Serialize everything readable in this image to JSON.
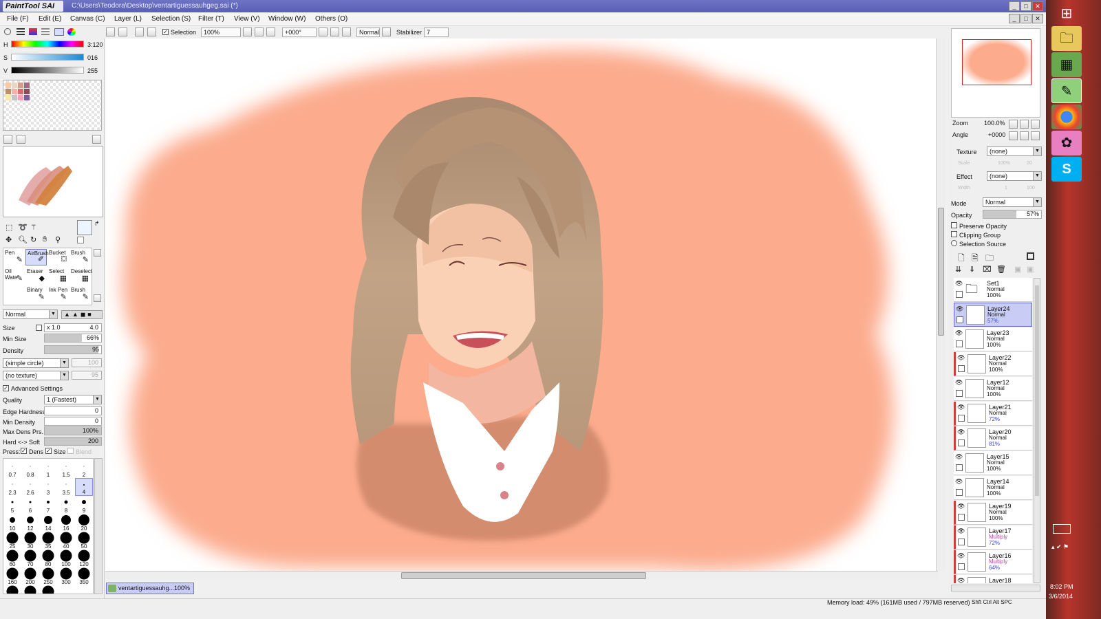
{
  "window": {
    "app_name": "PaintTool SAI",
    "title_path": "C:\\Users\\Teodora\\Desktop\\ventartiguessauhgeg.sai (*)"
  },
  "menu": [
    "File (F)",
    "Edit (E)",
    "Canvas (C)",
    "Layer (L)",
    "Selection (S)",
    "Filter (T)",
    "View (V)",
    "Window (W)",
    "Others (O)"
  ],
  "toolbar": {
    "selection_label": "Selection",
    "zoom": "100%",
    "angle": "+000°",
    "blend_mode": "Normal",
    "stabilizer_label": "Stabilizer",
    "stabilizer_value": "7"
  },
  "color": {
    "h_label": "H",
    "h_value": "3:120",
    "s_label": "S",
    "s_value": "016",
    "v_label": "V",
    "v_value": "255",
    "swatches": [
      "#f7c9a8",
      "#e8d7c6",
      "#d69c8a",
      "#a46b80",
      "#b88f6d",
      "#f3b2a5",
      "#d56c6c",
      "#8c4a5c",
      "#f7e8a8",
      "#c4c4c4",
      "#f2a1b9",
      "#7e5a9a"
    ]
  },
  "tools": [
    {
      "name": "Pen",
      "icon": "✎",
      "selected": false
    },
    {
      "name": "AirBrush",
      "icon": "✐",
      "selected": true
    },
    {
      "name": "Bucket",
      "icon": "⛋",
      "selected": false
    },
    {
      "name": "Brush",
      "icon": "✎",
      "selected": false
    },
    {
      "name": "Oil Wate",
      "icon": "✎",
      "selected": false
    },
    {
      "name": "Eraser",
      "icon": "◆",
      "selected": false
    },
    {
      "name": "Select",
      "icon": "▦",
      "selected": false
    },
    {
      "name": "Deselect",
      "icon": "▦",
      "selected": false
    },
    {
      "name": "",
      "icon": "",
      "selected": false
    },
    {
      "name": "Binary",
      "icon": "✎",
      "selected": false
    },
    {
      "name": "Ink Pen",
      "icon": "✎",
      "selected": false
    },
    {
      "name": "Brush",
      "icon": "✎",
      "selected": false
    }
  ],
  "brush": {
    "mode": "Normal",
    "size_label": "Size",
    "size_multiplier": "x 1.0",
    "size_value": "4.0",
    "min_size_label": "Min Size",
    "min_size_value": "66%",
    "min_size_frac": 0.66,
    "density_label": "Density",
    "density_value": "95",
    "density_frac": 0.95,
    "shape": "(simple circle)",
    "shape_strength": "100",
    "texture": "(no texture)",
    "texture_strength": "95",
    "advanced_label": "Advanced Settings",
    "quality_label": "Quality",
    "quality_value": "1 (Fastest)",
    "edge_hardness_label": "Edge Hardness",
    "edge_hardness_value": "0",
    "min_density_label": "Min Density",
    "min_density_value": "0",
    "max_dens_label": "Max Dens Prs.",
    "max_dens_value": "100%",
    "hard_soft_label": "Hard <-> Soft",
    "hard_soft_value": "200",
    "press_label": "Press:",
    "press_dens_label": "Dens",
    "press_size_label": "Size",
    "press_blend_label": "Blend"
  },
  "brush_sizes": [
    {
      "v": "0.7",
      "d": 1
    },
    {
      "v": "0.8",
      "d": 1
    },
    {
      "v": "1",
      "d": 1
    },
    {
      "v": "1.5",
      "d": 1
    },
    {
      "v": "2",
      "d": 1
    },
    {
      "v": "2.3",
      "d": 1
    },
    {
      "v": "2.6",
      "d": 1
    },
    {
      "v": "3",
      "d": 1
    },
    {
      "v": "3.5",
      "d": 1
    },
    {
      "v": "4",
      "d": 2,
      "selected": true
    },
    {
      "v": "5",
      "d": 3
    },
    {
      "v": "6",
      "d": 3
    },
    {
      "v": "7",
      "d": 4
    },
    {
      "v": "8",
      "d": 5
    },
    {
      "v": "9",
      "d": 6
    },
    {
      "v": "10",
      "d": 8
    },
    {
      "v": "12",
      "d": 10
    },
    {
      "v": "14",
      "d": 12
    },
    {
      "v": "16",
      "d": 14
    },
    {
      "v": "20",
      "d": 16
    },
    {
      "v": "25",
      "d": 17
    },
    {
      "v": "30",
      "d": 17
    },
    {
      "v": "35",
      "d": 17
    },
    {
      "v": "40",
      "d": 17
    },
    {
      "v": "50",
      "d": 17
    },
    {
      "v": "60",
      "d": 17
    },
    {
      "v": "70",
      "d": 17
    },
    {
      "v": "80",
      "d": 17
    },
    {
      "v": "100",
      "d": 17
    },
    {
      "v": "120",
      "d": 17
    },
    {
      "v": "160",
      "d": 17
    },
    {
      "v": "200",
      "d": 17
    },
    {
      "v": "250",
      "d": 17
    },
    {
      "v": "300",
      "d": 17
    },
    {
      "v": "350",
      "d": 17
    },
    {
      "v": "",
      "d": 17
    },
    {
      "v": "",
      "d": 17
    },
    {
      "v": "",
      "d": 17
    }
  ],
  "navigator": {
    "zoom_label": "Zoom",
    "zoom_value": "100.0%",
    "angle_label": "Angle",
    "angle_value": "+0000"
  },
  "layer_props": {
    "texture_label": "Texture",
    "texture_value": "(none)",
    "scale_label": "Scale",
    "scale_value": "100%",
    "scale_extra": "20",
    "effect_label": "Effect",
    "effect_value": "(none)",
    "width_label": "Width",
    "width_value": "1",
    "width_extra": "100",
    "mode_label": "Mode",
    "mode_value": "Normal",
    "opacity_label": "Opacity",
    "opacity_value": "57%",
    "opacity_frac": 0.57,
    "preserve_opacity": "Preserve Opacity",
    "clipping_group": "Clipping Group",
    "selection_source": "Selection Source"
  },
  "layers": [
    {
      "name": "Set1",
      "mode": "Normal",
      "opacity": "100%",
      "folder": true
    },
    {
      "name": "Layer24",
      "mode": "Normal",
      "opacity": "57%",
      "selected": true
    },
    {
      "name": "Layer23",
      "mode": "Normal",
      "opacity": "100%"
    },
    {
      "name": "Layer22",
      "mode": "Normal",
      "opacity": "100%",
      "red": true
    },
    {
      "name": "Layer12",
      "mode": "Normal",
      "opacity": "100%"
    },
    {
      "name": "Layer21",
      "mode": "Normal",
      "opacity": "72%",
      "red": true
    },
    {
      "name": "Layer20",
      "mode": "Normal",
      "opacity": "81%",
      "red": true
    },
    {
      "name": "Layer15",
      "mode": "Normal",
      "opacity": "100%"
    },
    {
      "name": "Layer14",
      "mode": "Normal",
      "opacity": "100%"
    },
    {
      "name": "Layer19",
      "mode": "Normal",
      "opacity": "100%",
      "red": true
    },
    {
      "name": "Layer17",
      "mode": "Multiply",
      "opacity": "72%",
      "red": true
    },
    {
      "name": "Layer16",
      "mode": "Multiply",
      "opacity": "64%",
      "red": true
    },
    {
      "name": "Layer18",
      "mode": "",
      "opacity": "",
      "red": true
    }
  ],
  "file_tab": {
    "name": "ventartiguessauhg...",
    "zoom": "100%"
  },
  "status": {
    "memory": "Memory load: 49% (161MB used / 797MB reserved)",
    "keys": "Shft Ctrl Alt SPC"
  },
  "taskbar": {
    "time": "8:02 PM",
    "date": "3/6/2014"
  }
}
